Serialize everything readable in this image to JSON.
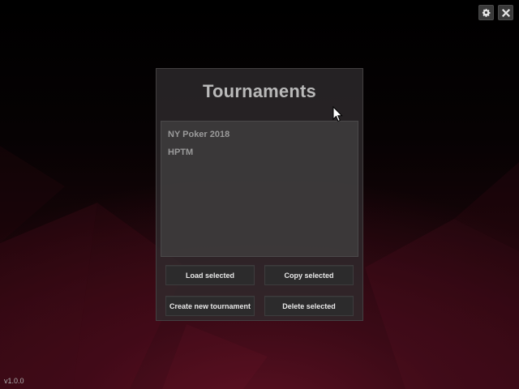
{
  "window": {
    "settings_icon": "gear-icon",
    "close_icon": "close-icon"
  },
  "dialog": {
    "title": "Tournaments",
    "tournaments": [
      "NY Poker 2018",
      "HPTM"
    ],
    "buttons": {
      "load": "Load selected",
      "copy": "Copy selected",
      "create": "Create new tournament",
      "delete": "Delete selected"
    }
  },
  "footer": {
    "version": "v1.0.0"
  },
  "colors": {
    "background_accent": "#5c1022",
    "panel": "#302c2e",
    "button": "#2c2b2c",
    "title_text": "#b9b9b9"
  }
}
